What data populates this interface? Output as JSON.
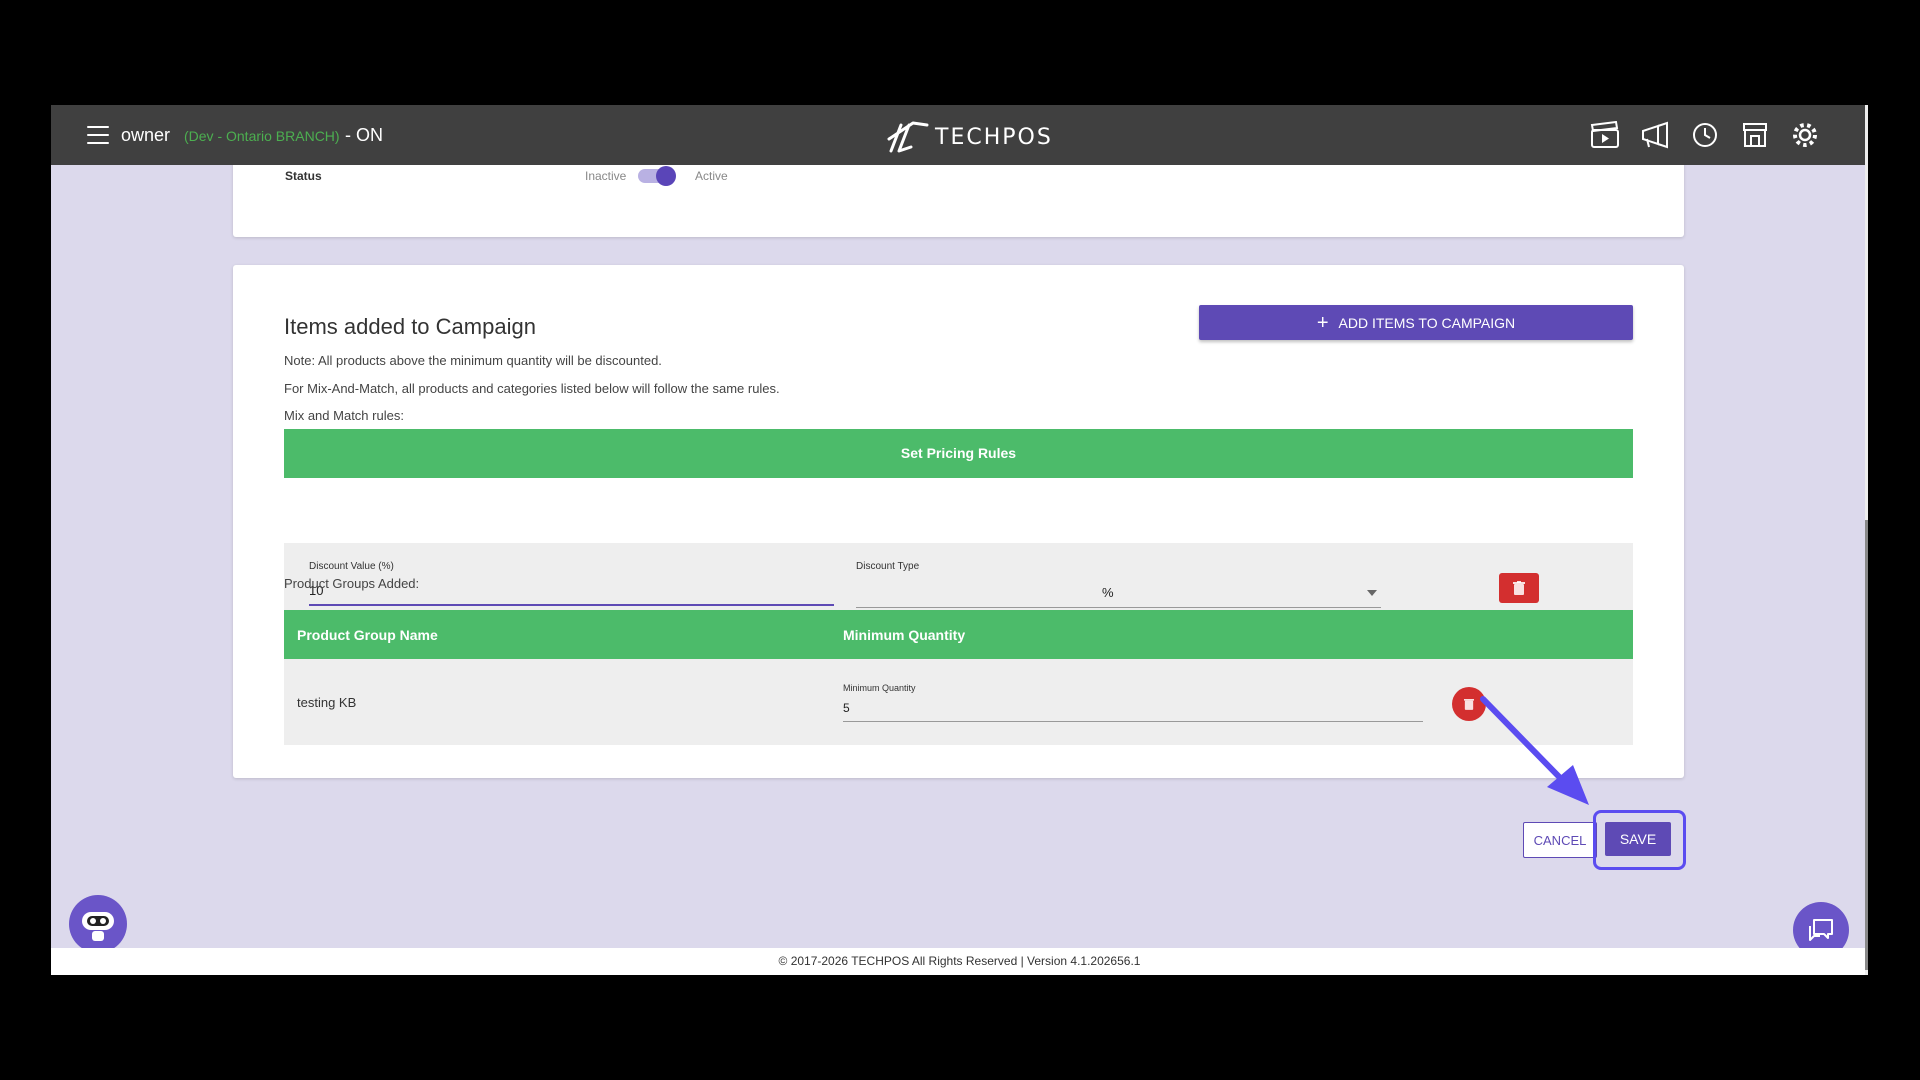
{
  "header": {
    "user": "owner",
    "branch": "(Dev - Ontario BRANCH)",
    "online_status": "- ON",
    "logo_text": "TECHPOS",
    "icons": [
      "video-icon",
      "megaphone-icon",
      "clock-icon",
      "store-icon",
      "gear-icon"
    ]
  },
  "status_card": {
    "label": "Status",
    "inactive": "Inactive",
    "active": "Active"
  },
  "items_card": {
    "title": "Items added to Campaign",
    "note1": "Note: All products above the minimum quantity will be discounted.",
    "note2": "For Mix-And-Match, all products and categories listed below will follow the same rules.",
    "mix_rules_label": "Mix and Match rules:",
    "add_button": "ADD ITEMS TO CAMPAIGN",
    "pricing_header": "Set Pricing Rules",
    "discount_value_label": "Discount Value (%)",
    "discount_value": "10",
    "discount_type_label": "Discount Type",
    "discount_type": "%",
    "product_groups_label": "Product Groups Added:",
    "col_group_name": "Product Group Name",
    "col_min_qty": "Minimum Quantity",
    "group_name": "testing KB",
    "min_qty_label": "Minimum Quantity",
    "min_qty": "5"
  },
  "actions": {
    "cancel": "CANCEL",
    "save": "SAVE"
  },
  "footer": {
    "text": "© 2017-2026 TECHPOS All Rights Reserved | Version 4.1.202656.1"
  },
  "colors": {
    "accent": "#5e4ab5",
    "green": "#4cbb6a",
    "danger": "#d32f2f",
    "background": "#dcd9ec"
  }
}
